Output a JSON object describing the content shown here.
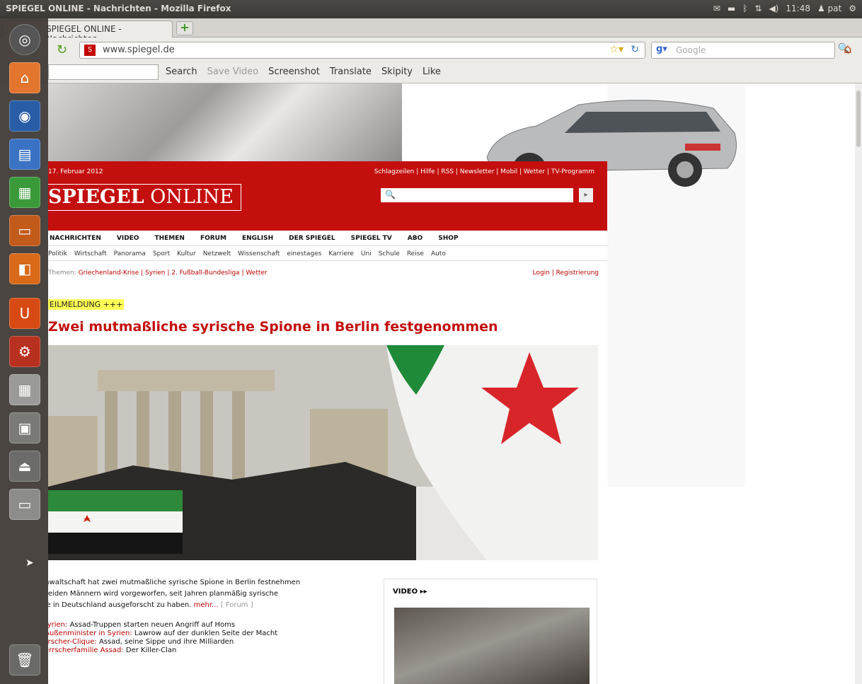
{
  "window": {
    "title": "SPIEGEL ONLINE - Nachrichten - Mozilla Firefox"
  },
  "tray": {
    "time": "11:48",
    "user": "pat"
  },
  "tabs": [
    {
      "label": "SPIEGEL ONLINE - Nachrichten"
    }
  ],
  "nav": {
    "url": "www.spiegel.de",
    "search_placeholder": "Google"
  },
  "toolbar": {
    "search": "Search",
    "save_video": "Save Video",
    "screenshot": "Screenshot",
    "translate": "Translate",
    "skipity": "Skipity",
    "like": "Like"
  },
  "page": {
    "date": "17. Februar 2012",
    "top_links": "Schlagzeilen | Hilfe | RSS | Newsletter | Mobil | Wetter | TV-Programm",
    "logo_a": "SPIEGEL",
    "logo_b": "ONLINE",
    "main_nav": [
      "NACHRICHTEN",
      "VIDEO",
      "THEMEN",
      "FORUM",
      "ENGLISH",
      "DER SPIEGEL",
      "SPIEGEL TV",
      "ABO",
      "SHOP"
    ],
    "sub_nav": [
      "Politik",
      "Wirtschaft",
      "Panorama",
      "Sport",
      "Kultur",
      "Netzwelt",
      "Wissenschaft",
      "einestages",
      "Karriere",
      "Uni",
      "Schule",
      "Reise",
      "Auto"
    ],
    "themen_label": "Themen:",
    "themen_links": "Griechenland-Krise | Syrien | 2. Fußball-Bundesliga | Wetter",
    "login": "Login | Registrierung",
    "eilmeldung": "EILMELDUNG +++",
    "headline": "Zwei mutmaßliche syrische Spione in Berlin festgenommen",
    "teaser": "Die Bundesanwaltschaft hat zwei mutmaßliche syrische Spione in Berlin festnehmen lassen. Den beiden Männern wird vorgeworfen, seit Jahren planmäßig syrische Oppositionelle in Deutschland ausgeforscht zu haben.",
    "more": "mehr...",
    "forum": "[ Forum ]",
    "bullets": [
      {
        "k": "Gewalt in Syrien:",
        "t": "Assad-Truppen starten neuen Angriff auf Homs"
      },
      {
        "k": "Russlands Außenminister in Syrien:",
        "t": "Lawrow auf der dunklen Seite der Macht"
      },
      {
        "k": "Syriens Herrscher-Clique:",
        "t": "Assad, seine Sippe und ihre Milliarden"
      },
      {
        "k": "Syrische Herrscherfamilie Assad:",
        "t": "Der Killer-Clan"
      }
    ],
    "video_label": "VIDEO ▸▸"
  },
  "launcher": [
    "dash-icon",
    "home-folder-icon",
    "firefox-icon",
    "writer-icon",
    "calc-icon",
    "impress-icon",
    "software-center-icon",
    "ubuntu-one-icon",
    "system-settings-icon",
    "calculator-icon",
    "workspace-switcher-icon",
    "usb-drive-icon",
    "removable-disk-icon",
    "trash-icon"
  ]
}
